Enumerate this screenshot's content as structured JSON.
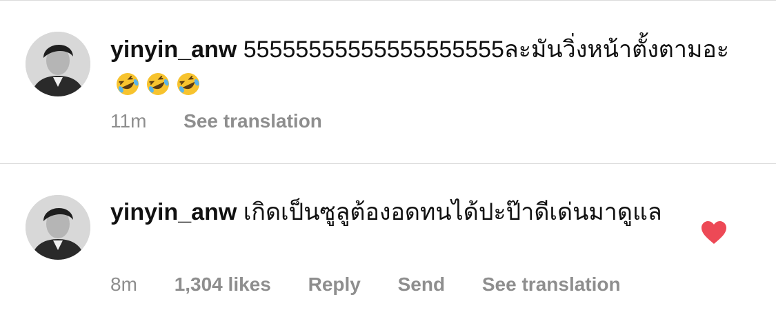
{
  "comments": [
    {
      "username": "yinyin_anw",
      "text": "55555555555555555555ละมันวิ่งหน้าตั้งตามอะ",
      "emoji_icon": "rolling-on-floor-laughing-icon",
      "emoji_count": 3,
      "time": "11m",
      "see_translation": "See translation"
    },
    {
      "username": "yinyin_anw",
      "text": "เกิดเป็นซูลูต้องอดทนได้ปะป๊าดีเด่นมาดูแล",
      "time": "8m",
      "likes": "1,304 likes",
      "reply": "Reply",
      "send": "Send",
      "see_translation": "See translation",
      "liked": true,
      "heart_color": "#ed4956"
    }
  ]
}
